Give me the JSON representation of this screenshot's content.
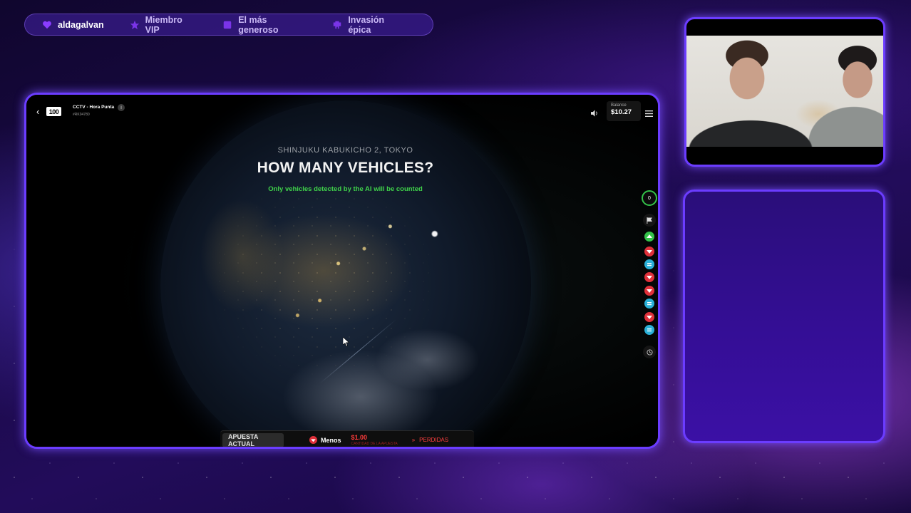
{
  "alerts": [
    {
      "label": "aldagalvan",
      "icon": "heart-icon"
    },
    {
      "label": "Miembro VIP",
      "icon": "star-icon"
    },
    {
      "label": "El más generoso",
      "icon": "gift-icon"
    },
    {
      "label": "Invasión épica",
      "icon": "invader-icon"
    }
  ],
  "game": {
    "back_glyph": "‹",
    "logo_text": "100",
    "title": "CCTV - Hora Punta",
    "info_glyph": "i",
    "round_id": "#RK04780",
    "balance_label": "Balance",
    "balance_value": "$10.27",
    "location": "SHINJUKU KABUKICHO 2, TOKYO",
    "question": "HOW MANY VEHICLES?",
    "subtitle": "Only vehicles detected by the AI will be counted",
    "counter": "0",
    "bet": {
      "label": "APUESTA ACTUAL",
      "choice": "Menos",
      "amount": "$1.00",
      "amount_label": "CANTIDAD DE LA APUESTA",
      "outcome_arrow": "»",
      "outcome": "PERDIDAS"
    }
  },
  "colors": {
    "frame_border": "#6b3cff",
    "win_green": "#34c34a",
    "lose_red": "#e0303a",
    "push_blue": "#2ab0d8",
    "subtitle_green": "#3fd24a"
  },
  "history_chips": [
    "green-up",
    "red-down",
    "blue-equal",
    "red-down",
    "red-down",
    "blue-equal",
    "red-down",
    "blue-equal"
  ]
}
